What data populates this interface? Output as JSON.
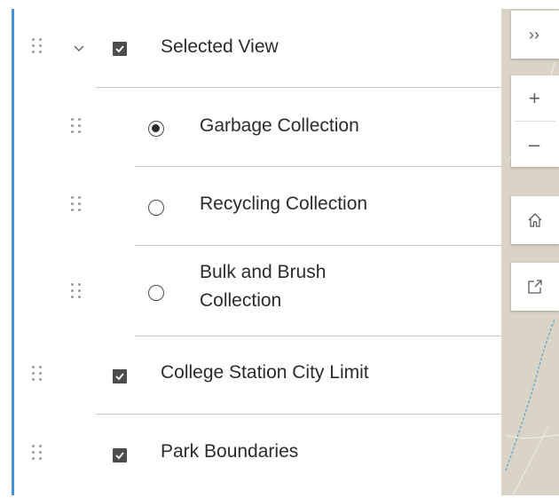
{
  "toolbar": {
    "expand_label": "››",
    "zoom_in_label": "+",
    "zoom_out_label": "–"
  },
  "icons": [
    "drag-handle-icon",
    "chevron-down-icon",
    "checkbox-checked-icon",
    "radio-selected-icon",
    "radio-unselected-icon",
    "home-icon",
    "share-icon"
  ],
  "layers": {
    "group": {
      "label": "Selected View",
      "checked": true,
      "expanded": true
    },
    "sublayers": [
      {
        "label": "Garbage Collection",
        "selected": true
      },
      {
        "label": "Recycling Collection",
        "selected": false
      },
      {
        "label_line1": "Bulk and Brush",
        "label_line2": "Collection",
        "selected": false
      }
    ],
    "city_limit": {
      "label": "College Station City Limit",
      "checked": true
    },
    "parks": {
      "label": "Park Boundaries",
      "checked": true
    }
  },
  "colors": {
    "panel_accent": "#4a90d9",
    "checkbox_fill": "#4c4c4c",
    "map_background": "#d9d4c5",
    "map_road": "#5ba4d6"
  }
}
